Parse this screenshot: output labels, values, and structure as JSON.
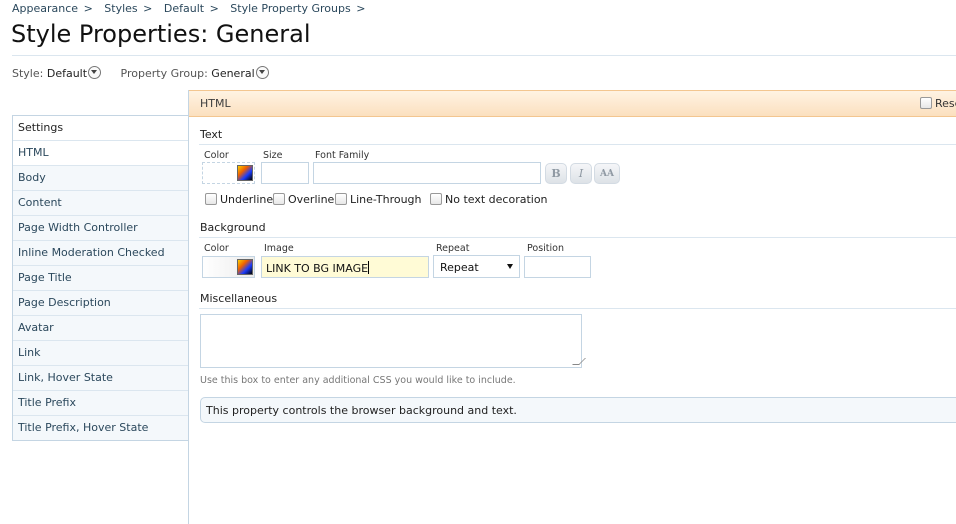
{
  "breadcrumb": [
    {
      "label": "Appearance"
    },
    {
      "label": "Styles"
    },
    {
      "label": "Default"
    },
    {
      "label": "Style Property Groups"
    }
  ],
  "breadcrumb_sep": ">",
  "page_title": "Style Properties: General",
  "selectors": {
    "style_label": "Style:",
    "style_value": "Default",
    "group_label": "Property Group:",
    "group_value": "General"
  },
  "sidebar": {
    "items": [
      {
        "label": "Settings"
      },
      {
        "label": "HTML"
      },
      {
        "label": "Body"
      },
      {
        "label": "Content"
      },
      {
        "label": "Page Width Controller"
      },
      {
        "label": "Inline Moderation Checked"
      },
      {
        "label": "Page Title"
      },
      {
        "label": "Page Description"
      },
      {
        "label": "Avatar"
      },
      {
        "label": "Link"
      },
      {
        "label": "Link, Hover State"
      },
      {
        "label": "Title Prefix"
      },
      {
        "label": "Title Prefix, Hover State"
      }
    ]
  },
  "panel": {
    "header": "HTML",
    "reset_label": "Rese"
  },
  "text_section": {
    "title": "Text",
    "color_label": "Color",
    "size_label": "Size",
    "font_family_label": "Font Family",
    "bold_label": "B",
    "italic_label": "I",
    "caps_label": "AA",
    "underline_label": "Underline",
    "overline_label": "Overline",
    "linethrough_label": "Line-Through",
    "nodecoration_label": "No text decoration"
  },
  "background_section": {
    "title": "Background",
    "color_label": "Color",
    "image_label": "Image",
    "image_value": "LINK TO BG IMAGE",
    "repeat_label": "Repeat",
    "repeat_value": "Repeat",
    "position_label": "Position"
  },
  "misc_section": {
    "title": "Miscellaneous",
    "hint": "Use this box to enter any additional CSS you would like to include."
  },
  "description": "This property controls the browser background and text.",
  "colors": {
    "link": "#2b485c",
    "header_bg": "#fde9d0",
    "border": "#c4d5e3",
    "image_input_bg": "#fffbd6"
  }
}
